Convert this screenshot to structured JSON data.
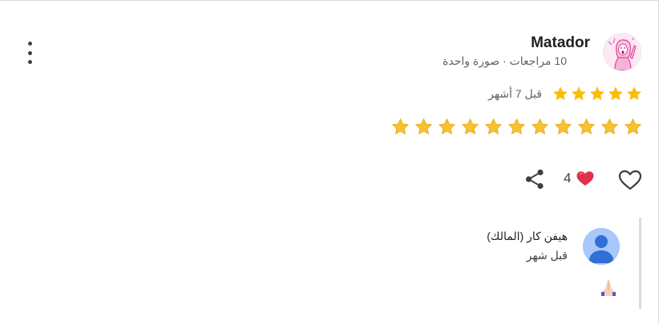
{
  "reviewer": {
    "name": "Matador",
    "meta": "10 مراجعات · صورة واحدة"
  },
  "rating": {
    "stars": 5,
    "time_ago": "قبل 7 أشهر",
    "star_color": "#fbbc04"
  },
  "review_text": {
    "emoji_icon": "star-emoji-icon",
    "count": 11
  },
  "actions": {
    "like_icon": "heart-outline-icon",
    "reaction_icon": "red-heart-icon",
    "reaction_count": "4",
    "share_icon": "share-icon"
  },
  "owner_reply": {
    "name": "هيفن كار (المالك)",
    "time_ago": "قبل شهر",
    "emoji_icon": "folded-hands-emoji-icon"
  }
}
